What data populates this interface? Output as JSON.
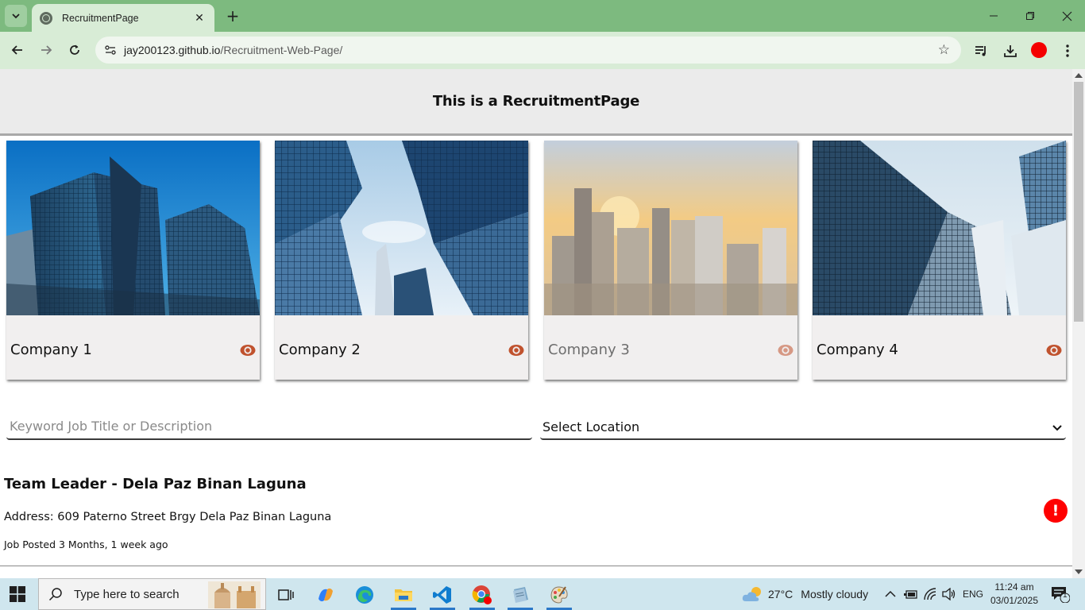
{
  "browser": {
    "tab_title": "RecruitmentPage",
    "url_host": "jay200123.github.io",
    "url_path": "/Recruitment-Web-Page/"
  },
  "page": {
    "heading": "This is a RecruitmentPage",
    "companies": [
      {
        "name": "Company 1"
      },
      {
        "name": "Company 2"
      },
      {
        "name": "Company 3"
      },
      {
        "name": "Company 4"
      }
    ],
    "search": {
      "placeholder": "Keyword Job Title or Description"
    },
    "location": {
      "selected": "Select Location"
    },
    "job": {
      "title": "Team Leader - Dela Paz Binan Laguna",
      "address": "Address: 609 Paterno Street Brgy Dela Paz Binan Laguna",
      "posted": "Job Posted 3 Months, 1 week ago",
      "alert": "!"
    }
  },
  "taskbar": {
    "search_placeholder": "Type here to search",
    "weather_temp": "27°C",
    "weather_desc": "Mostly cloudy",
    "language": "ENG",
    "time": "11:24 am",
    "date": "03/01/2025",
    "notification_count": "1"
  },
  "colors": {
    "eye_icon": "#c0522e",
    "alert": "#ff0000",
    "browser_frame": "#7dba7f"
  }
}
